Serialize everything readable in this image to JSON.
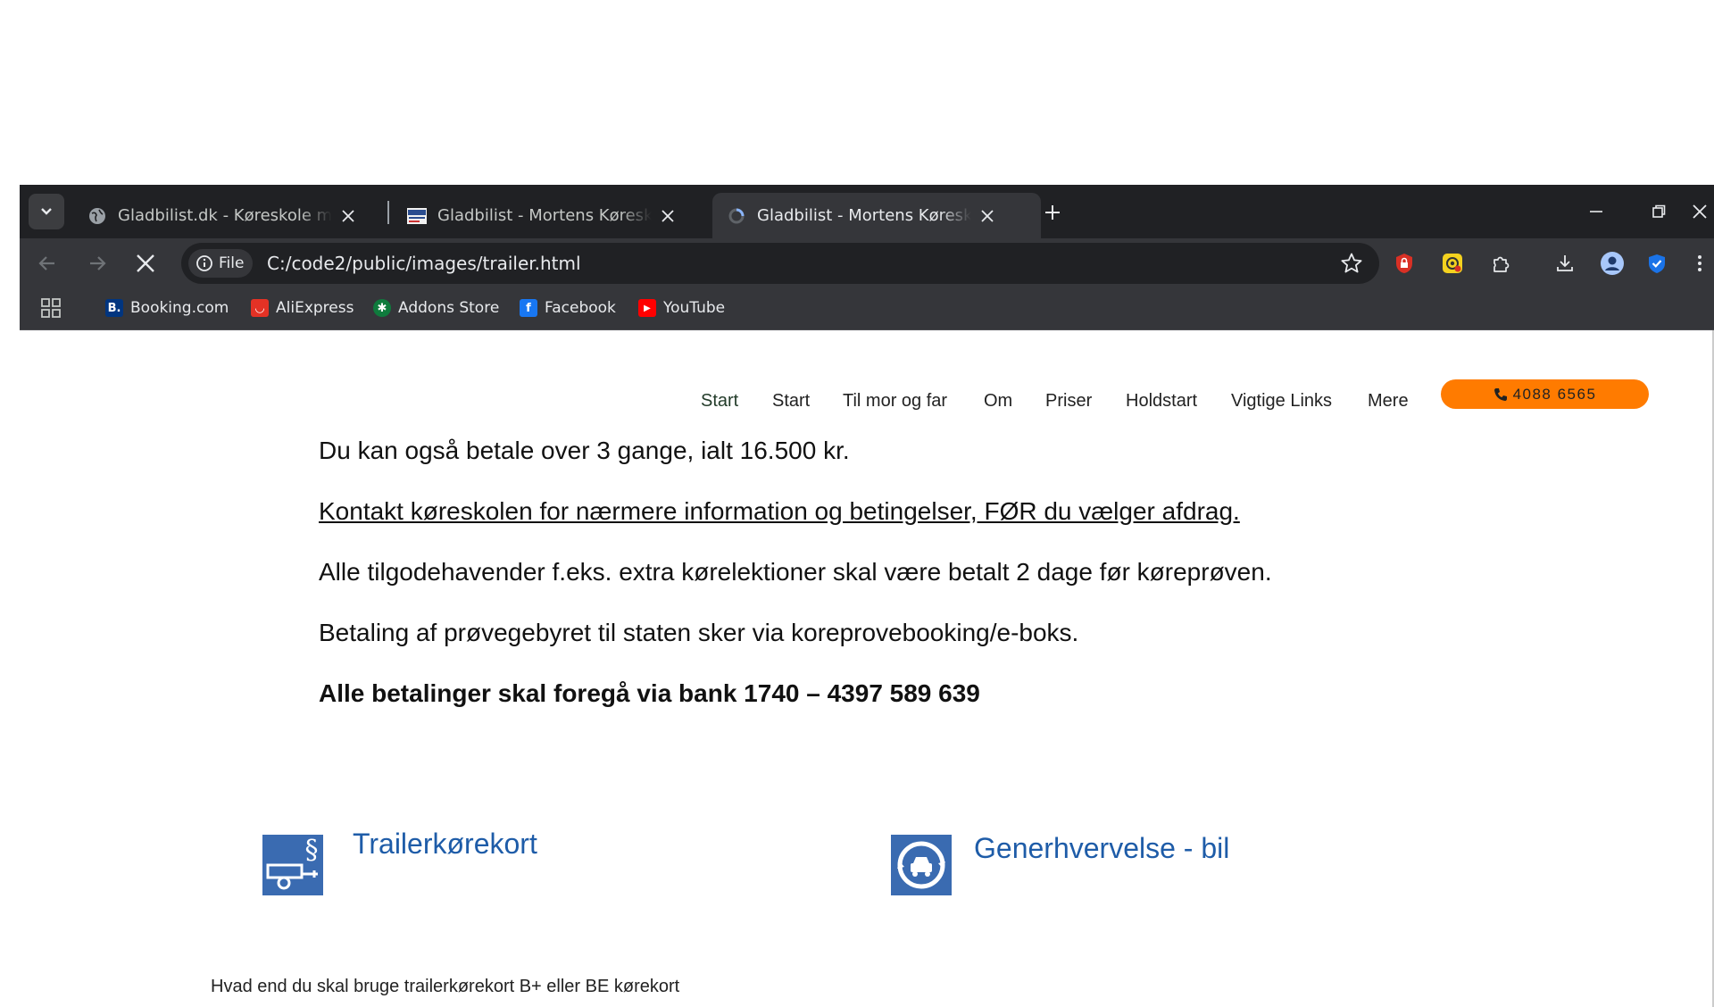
{
  "tabs": [
    {
      "title": "Gladbilist.dk - Køreskole med kø",
      "active": false,
      "favicon": "globe-icon"
    },
    {
      "title": "Gladbilist - Mortens Køreskole /",
      "active": false,
      "favicon": "mortens-logo-icon"
    },
    {
      "title": "Gladbilist - Mortens Køreskole /",
      "active": true,
      "favicon": "loading-icon"
    }
  ],
  "address_bar": {
    "scheme_label": "File",
    "url": "C:/code2/public/images/trailer.html"
  },
  "bookmarks": [
    {
      "label": "Booking.com",
      "icon": "booking-icon",
      "glyph": "B.",
      "color": "#003580"
    },
    {
      "label": "AliExpress",
      "icon": "aliexpress-icon",
      "glyph": "◡",
      "color": "#e43225"
    },
    {
      "label": "Addons Store",
      "icon": "addons-store-icon",
      "glyph": "✱",
      "color": "#0f7b3d"
    },
    {
      "label": "Facebook",
      "icon": "facebook-icon",
      "glyph": "f",
      "color": "#1877f2"
    },
    {
      "label": "YouTube",
      "icon": "youtube-icon",
      "glyph": "▶",
      "color": "#ff0000"
    }
  ],
  "site_nav": {
    "items": [
      "Start",
      "Start",
      "Til mor og far",
      "Om",
      "Priser",
      "Holdstart",
      "Vigtige Links",
      "Mere"
    ],
    "phone": "4088 6565",
    "phone_color": "#ff7b00"
  },
  "content": {
    "p1": "Du kan også betale over 3 gange, ialt 16.500 kr.",
    "p2": "Kontakt køreskolen for nærmere information og betingelser, FØR du vælger afdrag.",
    "p3": "Alle tilgodehavender f.eks. extra kørelektioner skal være betalt 2 dage før køreprøven.",
    "p4": "Betaling af prøvegebyret til staten sker via koreprovebooking/e-boks.",
    "p5": "Alle betalinger skal foregå via bank 1740 – 4397 589 639"
  },
  "cards": [
    {
      "title": "Trailerkørekort",
      "icon": "trailer-law-icon"
    },
    {
      "title": "Generhvervelse - bil",
      "icon": "car-renewal-icon"
    }
  ],
  "footer_text": "Hvad end du skal bruge trailerkørekort B+ eller BE kørekort",
  "colors": {
    "tabstrip": "#202124",
    "toolbar": "#35363a",
    "link_blue": "#1e5ca8",
    "icon_blue": "#3a6bb1"
  }
}
